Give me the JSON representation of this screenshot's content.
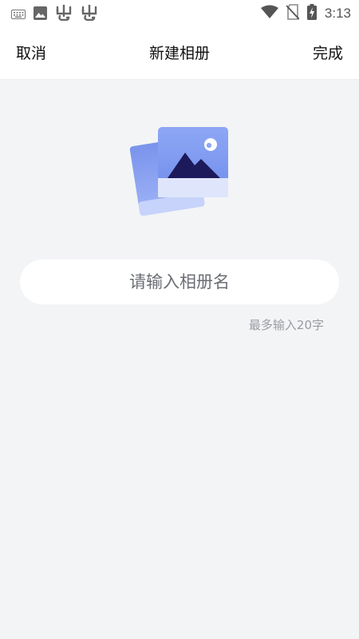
{
  "status_bar": {
    "time": "3:13",
    "left_icons": [
      "keyboard-icon",
      "image-icon",
      "bug-icon",
      "bug-icon"
    ],
    "right_icons": [
      "wifi-icon",
      "no-sim-icon",
      "battery-charging-icon"
    ]
  },
  "header": {
    "cancel_label": "取消",
    "title": "新建相册",
    "done_label": "完成"
  },
  "illustration": {
    "icon": "album-photos-icon",
    "colors": {
      "back_photo": "#7f97ee",
      "front_photo": "#8da6f4",
      "mountain": "#1c1a5a",
      "moon": "#ffffff"
    }
  },
  "album_name": {
    "placeholder": "请输入相册名",
    "value": "",
    "hint": "最多输入20字"
  }
}
